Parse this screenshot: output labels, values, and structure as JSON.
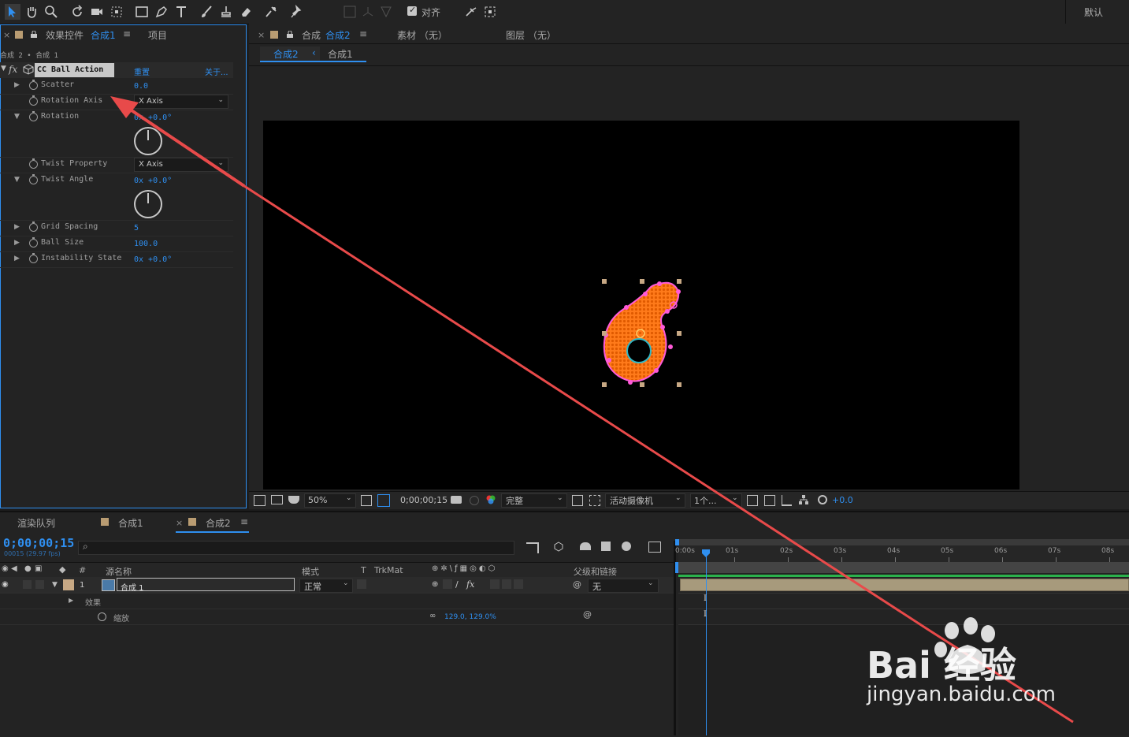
{
  "toolbar": {
    "align_label": "对齐",
    "workspace": "默认"
  },
  "effect_panel": {
    "tab_close": "×",
    "tab_prefix": "效果控件",
    "tab_comp": "合成1",
    "tab_menu": "≡",
    "project_tab": "项目",
    "breadcrumb": "合成 2 • 合成 1",
    "effect_name": "CC Ball Action",
    "reset": "重置",
    "about": "关于...",
    "props": [
      {
        "name": "Scatter",
        "value": "0.0"
      },
      {
        "name": "Rotation Axis",
        "value": "X Axis"
      },
      {
        "name": "Rotation",
        "value": "0x +0.0°"
      },
      {
        "name": "Twist Property",
        "value": "X Axis"
      },
      {
        "name": "Twist Angle",
        "value": "0x +0.0°"
      },
      {
        "name": "Grid Spacing",
        "value": "5"
      },
      {
        "name": "Ball Size",
        "value": "100.0"
      },
      {
        "name": "Instability State",
        "value": "0x +0.0°"
      }
    ]
  },
  "viewer": {
    "tab_close": "×",
    "tab_prefix": "合成",
    "tab_comp": "合成2",
    "tab_menu": "≡",
    "footage_tab": "素材 （无）",
    "layer_tab": "图层 （无）",
    "sub_active": "合成2",
    "sub_sep": "‹",
    "sub_other": "合成1",
    "zoom": "50%",
    "timecode": "0;00;00;15",
    "quality": "完整",
    "camera": "活动摄像机",
    "views": "1个...",
    "exposure": "+0.0"
  },
  "timeline": {
    "render_queue_tab": "渲染队列",
    "comp1_tab": "合成1",
    "comp2_tab": "合成2",
    "tab_close": "×",
    "tab_menu": "≡",
    "current_time": "0;00;00;15",
    "frame_info": "00015 (29.97 fps)",
    "search_icon": "⌕",
    "col_num": "#",
    "col_source": "源名称",
    "col_mode": "模式",
    "col_t": "T",
    "col_trkmat": "TrkMat",
    "col_parent": "父级和链接",
    "layer": {
      "index": "1",
      "name": "合成 1",
      "mode": "正常",
      "parent": "无"
    },
    "sub_effects": "效果",
    "sub_scale": "缩放",
    "scale_value": "129.0, 129.0%",
    "ruler": [
      "0:00s",
      "01s",
      "02s",
      "03s",
      "04s",
      "05s",
      "06s",
      "07s",
      "08s"
    ],
    "playhead_marker": "I"
  },
  "watermark": {
    "brand": "Bai 经验",
    "url": "jingyan.baidu.com"
  },
  "colors": {
    "accent": "#2f8ff0",
    "swatch": "#b99c72",
    "arrow": "#e84a4a",
    "shape_fill": "#ff7a1a",
    "mask": "#ff5ad8"
  }
}
